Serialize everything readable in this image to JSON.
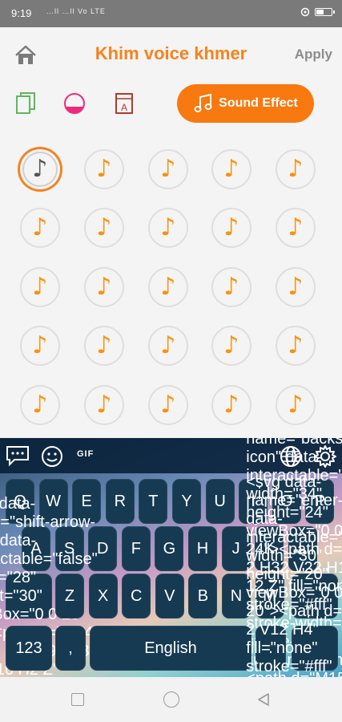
{
  "status_bar": {
    "time": "9:19",
    "signal_text": "…ll …ll Vo LTE",
    "battery_level": 0.55
  },
  "header": {
    "title": "Khim voice khmer",
    "apply_label": "Apply",
    "home_icon": "home-icon"
  },
  "toolbar": {
    "tools": [
      "copy-icon",
      "theme-circle-icon",
      "font-icon"
    ],
    "sound_effect_label": "Sound Effect",
    "accent_color": "#f7790f"
  },
  "sound_grid": {
    "rows": 5,
    "columns": 5,
    "selected_index": 0,
    "note_glyph": "♪",
    "note_color": "#f7930f"
  },
  "keyboard": {
    "topbar_icons": [
      "chat-icon",
      "emoji-icon",
      "globe-icon",
      "gear-icon"
    ],
    "gif_label": "GIF",
    "rows": [
      [
        "Q",
        "W",
        "E",
        "R",
        "T",
        "Y",
        "U",
        "I",
        "O",
        "P"
      ],
      [
        "A",
        "S",
        "D",
        "F",
        "G",
        "H",
        "J",
        "K",
        "L"
      ],
      [
        "Z",
        "X",
        "C",
        "V",
        "B",
        "N",
        "M"
      ]
    ],
    "shift_icon": "shift-arrow-icon",
    "backspace_icon": "backspace-icon",
    "numbers_label": "123",
    "comma_label": ",",
    "space_label": "English",
    "period_label": ".",
    "enter_icon": "enter-icon"
  },
  "nav_bar": {
    "icons": [
      "recent-apps-icon",
      "home-circle-icon",
      "back-triangle-icon"
    ]
  }
}
